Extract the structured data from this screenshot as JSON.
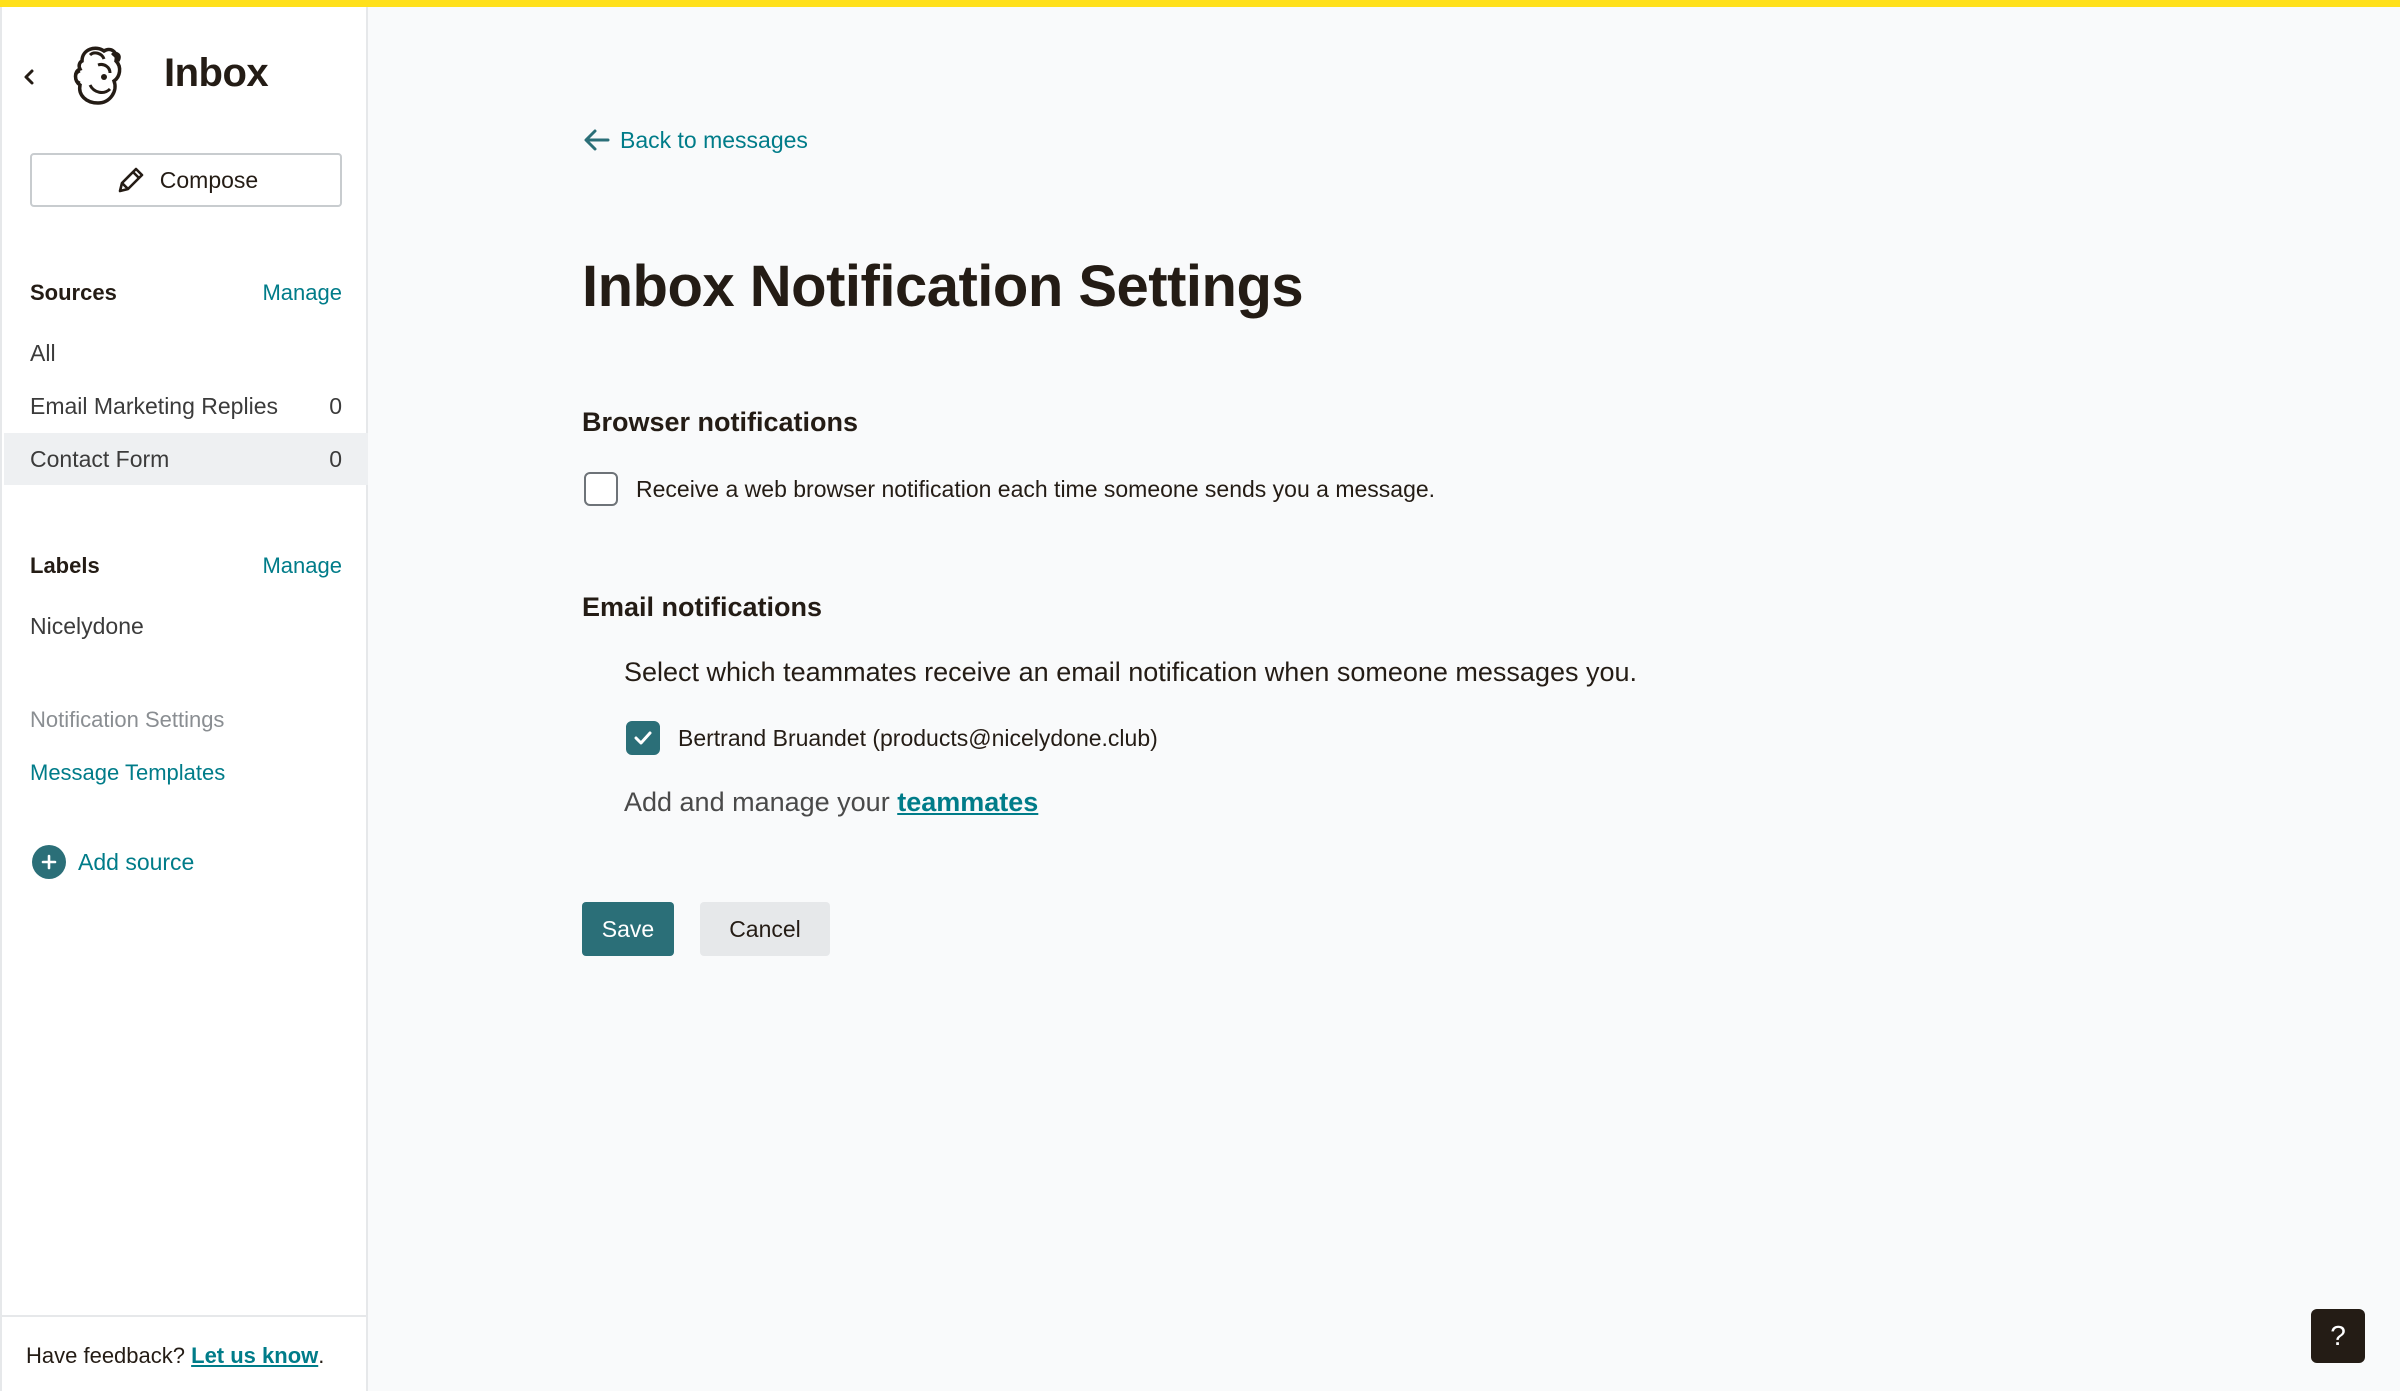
{
  "sidebar": {
    "title": "Inbox",
    "compose_label": "Compose",
    "sources": {
      "heading": "Sources",
      "manage_label": "Manage",
      "items": [
        {
          "label": "All",
          "count": ""
        },
        {
          "label": "Email Marketing Replies",
          "count": "0"
        },
        {
          "label": "Contact Form",
          "count": "0"
        }
      ]
    },
    "labels": {
      "heading": "Labels",
      "manage_label": "Manage",
      "items": [
        {
          "label": "Nicelydone"
        }
      ]
    },
    "links": {
      "notification_settings": "Notification Settings",
      "message_templates": "Message Templates"
    },
    "add_source_label": "Add source",
    "feedback": {
      "text": "Have feedback?",
      "link": "Let us know",
      "suffix": "."
    }
  },
  "main": {
    "back_label": "Back to messages",
    "title": "Inbox Notification Settings",
    "browser": {
      "heading": "Browser notifications",
      "checkbox_label": "Receive a web browser notification each time someone sends you a message.",
      "checked": false
    },
    "email": {
      "heading": "Email notifications",
      "description": "Select which teammates receive an email notification when someone messages you.",
      "teammate_label": "Bertrand Bruandet (products@nicelydone.club)",
      "teammate_checked": true,
      "manage_prefix": "Add and manage your",
      "manage_link": "teammates"
    },
    "save_label": "Save",
    "cancel_label": "Cancel"
  },
  "help_label": "?",
  "colors": {
    "accent": "#007c89",
    "button": "#2b6f78",
    "topbar": "#ffe01b"
  }
}
